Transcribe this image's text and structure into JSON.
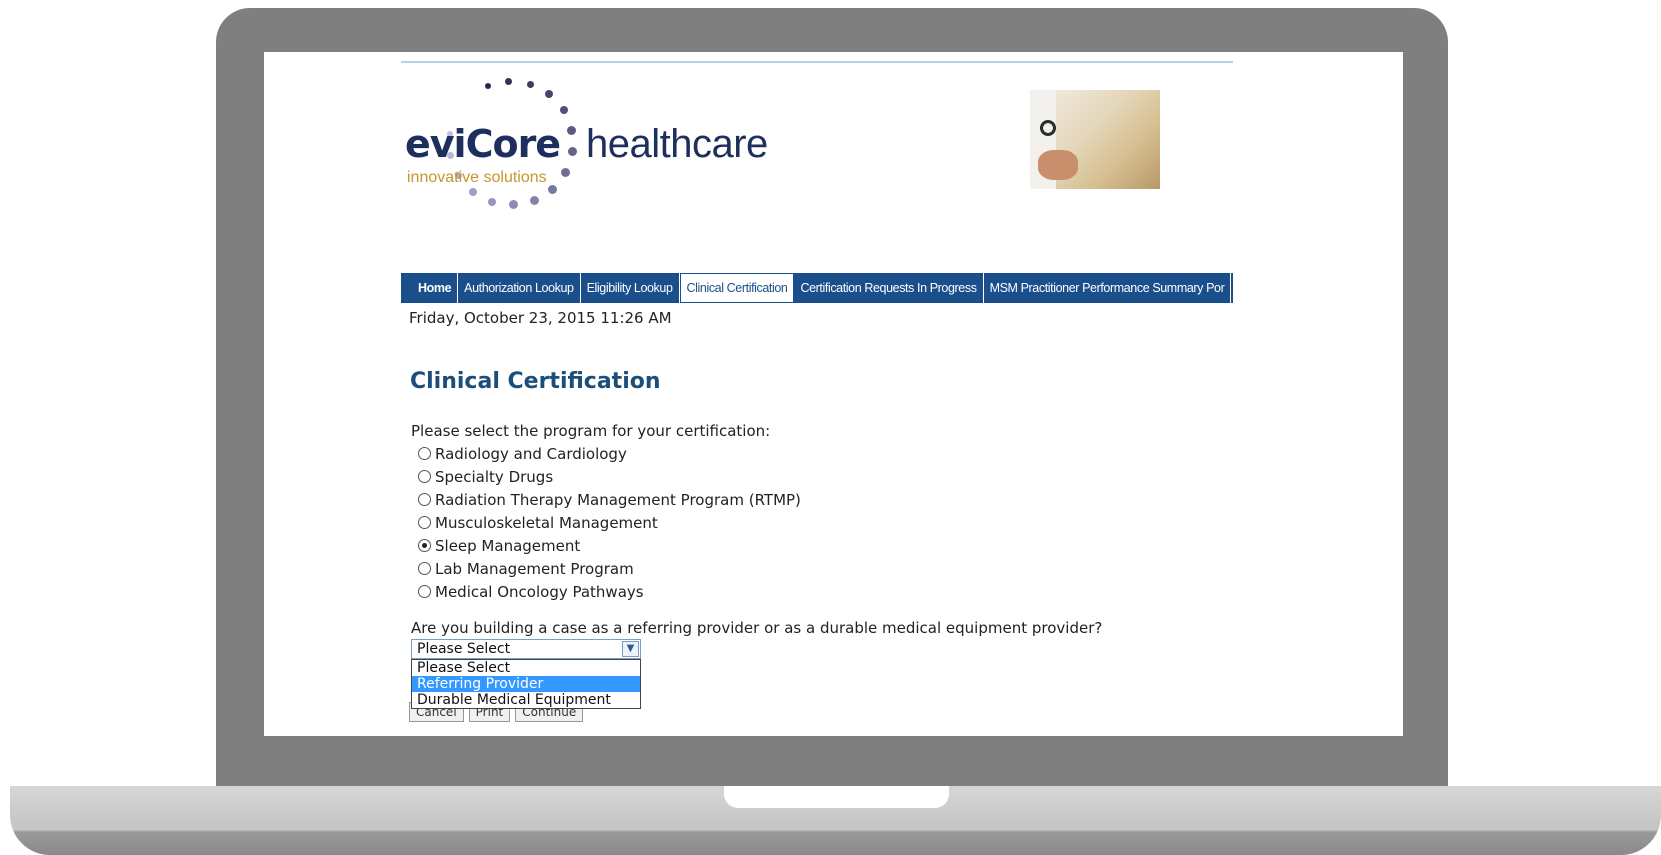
{
  "logo": {
    "brand": "eviCore",
    "tagline": "innovative solutions",
    "wordmark": "healthcare",
    "colors": {
      "navy": "#1d2f5c",
      "gold": "#c7962d"
    }
  },
  "header_photo": {
    "icon": "doctor-with-folder-photo"
  },
  "nav": {
    "items": [
      {
        "label": "Home"
      },
      {
        "label": "Authorization Lookup"
      },
      {
        "label": "Eligibility Lookup"
      },
      {
        "label": "Clinical Certification",
        "active": true
      },
      {
        "label": "Certification Requests In Progress"
      },
      {
        "label": "MSM Practitioner Performance Summary Por"
      }
    ],
    "bar_color": "#1b4f8c"
  },
  "datestamp": "Friday, October 23, 2015 11:26 AM",
  "page_title": "Clinical Certification",
  "program_prompt": "Please select the program for your certification:",
  "programs": [
    {
      "label": "Radiology and Cardiology",
      "checked": false
    },
    {
      "label": "Specialty Drugs",
      "checked": false
    },
    {
      "label": "Radiation Therapy Management Program (RTMP)",
      "checked": false
    },
    {
      "label": "Musculoskeletal Management",
      "checked": false
    },
    {
      "label": "Sleep Management",
      "checked": true
    },
    {
      "label": "Lab Management Program",
      "checked": false
    },
    {
      "label": "Medical Oncology Pathways",
      "checked": false
    }
  ],
  "provider_question": "Are you building a case as a referring provider or as a durable medical equipment provider?",
  "provider_select": {
    "value": "Please Select",
    "options": [
      "Please Select",
      "Referring Provider",
      "Durable Medical Equipment"
    ],
    "highlighted": "Referring Provider",
    "highlight_color": "#3399ff"
  },
  "buttons": {
    "cancel": "Cancel",
    "print": "Print",
    "continue": "Continue"
  }
}
